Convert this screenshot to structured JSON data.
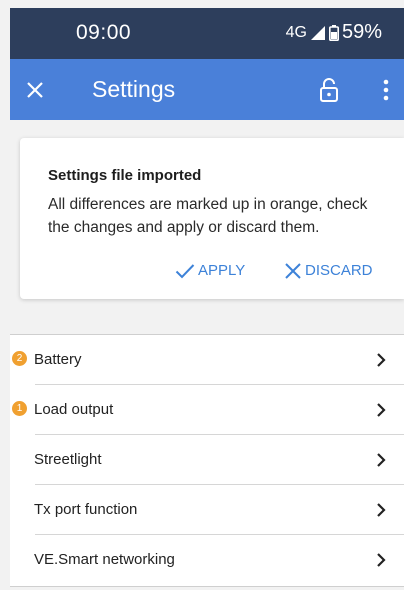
{
  "status_bar": {
    "time": "09:00",
    "network": "4G",
    "battery": "59%"
  },
  "app_bar": {
    "title": "Settings",
    "icons": [
      "close-icon",
      "lock-open-icon",
      "more-vert-icon"
    ]
  },
  "notice": {
    "title": "Settings file imported",
    "message": "All differences are marked up in orange, check the changes and apply or discard them.",
    "apply_label": "APPLY",
    "discard_label": "DISCARD",
    "accent_color": "#3d82d8"
  },
  "settings_list": {
    "items": [
      {
        "label": "Battery",
        "badge": "2"
      },
      {
        "label": "Load output",
        "badge": "1"
      },
      {
        "label": "Streetlight",
        "badge": ""
      },
      {
        "label": "Tx port function",
        "badge": ""
      },
      {
        "label": "VE.Smart networking",
        "badge": ""
      }
    ],
    "badge_color": "#f0a030"
  },
  "colors": {
    "status_bar": "#2d3e5c",
    "app_bar": "#4a80d9",
    "background": "#f2f2f2"
  }
}
